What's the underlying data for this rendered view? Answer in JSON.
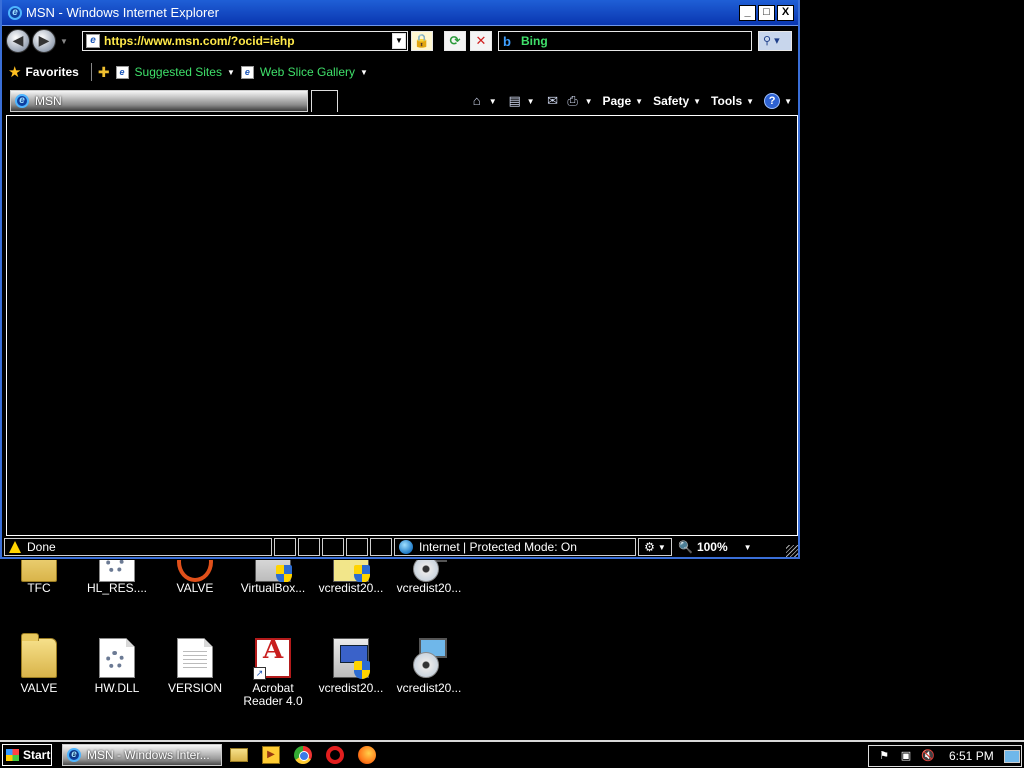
{
  "window": {
    "title": "MSN - Windows Internet Explorer",
    "minimize": "_",
    "maximize": "□",
    "close": "X"
  },
  "nav": {
    "back_glyph": "◀",
    "forward_glyph": "▶",
    "address_url": "https://www.msn.com/?ocid=iehp",
    "search_engine": "Bing",
    "search_glyph": "⚲"
  },
  "favorites_bar": {
    "favorites_label": "Favorites",
    "links": [
      {
        "label": "Suggested Sites"
      },
      {
        "label": "Web Slice Gallery"
      }
    ]
  },
  "tabs": [
    {
      "title": "MSN"
    }
  ],
  "command_bar": {
    "page_label": "Page",
    "safety_label": "Safety",
    "tools_label": "Tools",
    "help_glyph": "?"
  },
  "status_bar": {
    "status_text": "Done",
    "zone_text": "Internet | Protected Mode: On",
    "zoom_text": "100%"
  },
  "desktop_icons_row1": [
    {
      "label": "TFC",
      "icon": "folder-icon"
    },
    {
      "label": "HL_RES....",
      "icon": "settings-file-icon"
    },
    {
      "label": "VALVE",
      "icon": "valve-icon"
    },
    {
      "label": "VirtualBox...",
      "icon": "installer-icon"
    },
    {
      "label": "vcredist20...",
      "icon": "installer-icon"
    },
    {
      "label": "vcredist20...",
      "icon": "setup-cd-icon"
    }
  ],
  "desktop_icons_row2": [
    {
      "label": "VALVE",
      "icon": "folder-icon"
    },
    {
      "label": "HW.DLL",
      "icon": "dll-file-icon"
    },
    {
      "label": "VERSION",
      "icon": "text-file-icon"
    },
    {
      "label": "Acrobat\nReader 4.0",
      "icon": "acrobat-reader-icon"
    },
    {
      "label": "vcredist20...",
      "icon": "installer-icon"
    },
    {
      "label": "vcredist20...",
      "icon": "setup-cd-icon"
    }
  ],
  "taskbar": {
    "start_label": "Start",
    "active_task": "MSN - Windows Inter...",
    "clock": "6:51 PM"
  },
  "colors": {
    "titlebar": "#1f5fd6",
    "url_text": "#ffe94a",
    "link_text": "#3fe06a"
  }
}
